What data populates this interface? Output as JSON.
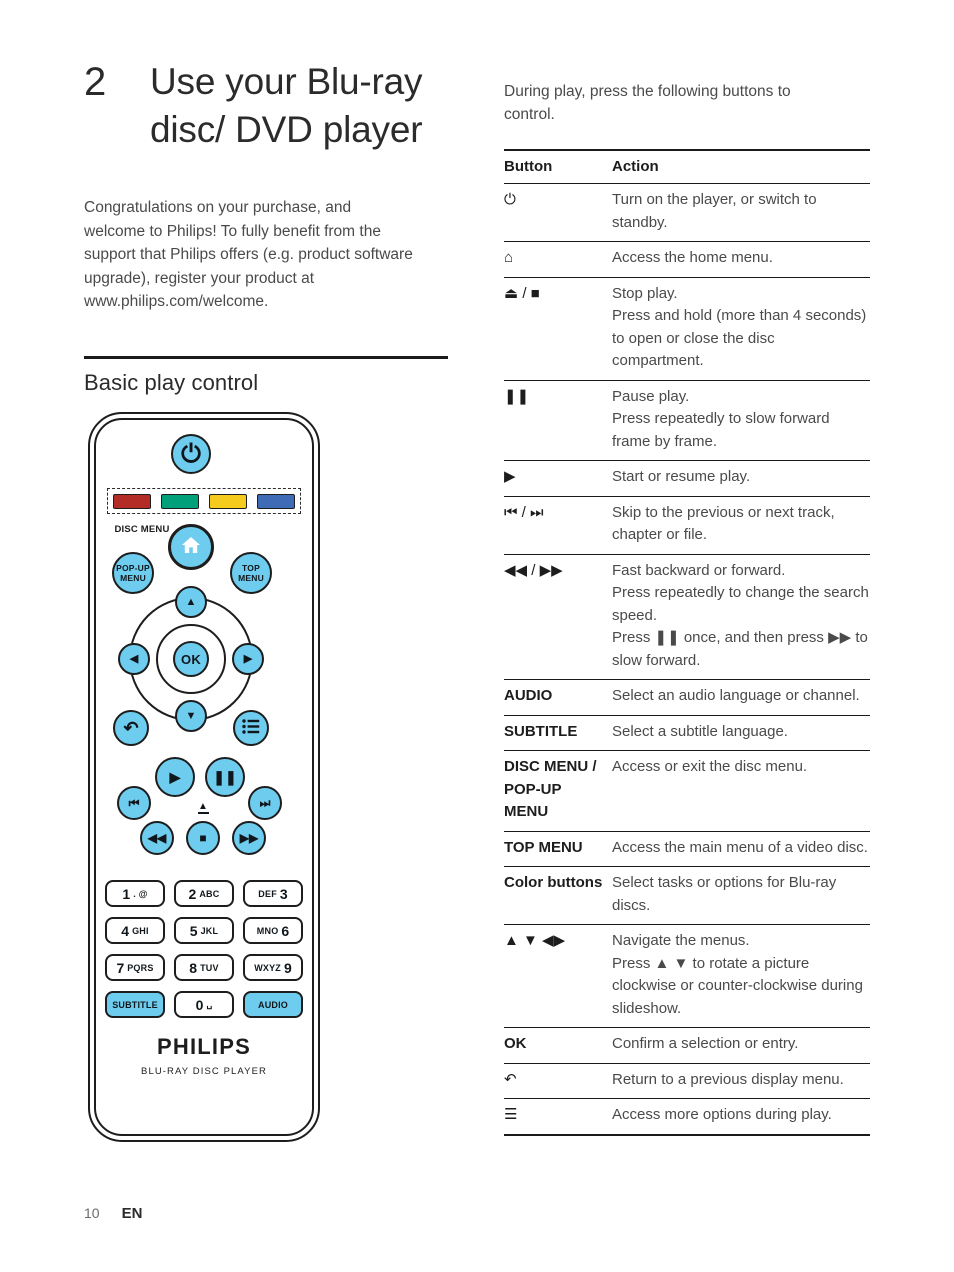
{
  "chapter": {
    "number": "2",
    "title": "Use your Blu-ray disc/ DVD player",
    "intro": "Congratulations on your purchase, and welcome to Philips! To fully benefit from the support that Philips offers (e.g. product software upgrade), register your product at www.philips.com/welcome."
  },
  "section": {
    "title": "Basic play control"
  },
  "remote": {
    "power_symbol": "⏻",
    "color_buttons": [
      {
        "name": "red",
        "hex": "#b32d26"
      },
      {
        "name": "green",
        "hex": "#00a07a"
      },
      {
        "name": "yellow",
        "hex": "#f5cb1e"
      },
      {
        "name": "blue",
        "hex": "#3f6ab5"
      }
    ],
    "home_symbol": "⌂",
    "disc_menu_label": "DISC MENU",
    "popup_menu_label": "POP-UP MENU",
    "top_menu_label": "TOP MENU",
    "nav_up": "▲",
    "nav_down": "▼",
    "nav_left": "◀",
    "nav_right": "▶",
    "ok_label": "OK",
    "back_symbol": "↶",
    "options_symbol": "☰",
    "play_symbol": "▶",
    "pause_symbol": "❚❚",
    "prev_symbol": "⏮",
    "next_symbol": "⏭",
    "rewind_symbol": "◀◀",
    "stop_symbol": "■",
    "forward_symbol": "▶▶",
    "eject_symbol": "▲",
    "keypad": [
      {
        "num": "1",
        "letters": ". @",
        "accent": false
      },
      {
        "num": "2",
        "letters": "ABC",
        "accent": false
      },
      {
        "num": "3",
        "letters": "DEF",
        "accent": false,
        "letters_first": true
      },
      {
        "num": "4",
        "letters": "GHI",
        "accent": false
      },
      {
        "num": "5",
        "letters": "JKL",
        "accent": false
      },
      {
        "num": "6",
        "letters": "MNO",
        "accent": false,
        "letters_first": true
      },
      {
        "num": "7",
        "letters": "PQRS",
        "accent": false
      },
      {
        "num": "8",
        "letters": "TUV",
        "accent": false
      },
      {
        "num": "9",
        "letters": "WXYZ",
        "accent": false,
        "letters_first": true
      },
      {
        "word": "SUBTITLE",
        "accent": true
      },
      {
        "num": "0",
        "letters": "␣",
        "accent": false
      },
      {
        "word": "AUDIO",
        "accent": true
      }
    ],
    "brand": "PHILIPS",
    "brand_sub": "BLU-RAY DISC PLAYER",
    "button_fill": "#6ecdef"
  },
  "right": {
    "lead": "During play, press the following buttons to control.",
    "table": {
      "headers": [
        "Button",
        "Action"
      ],
      "rows": [
        {
          "button": "⏻",
          "symbol": true,
          "lines": [
            "Turn on the player, or switch to standby."
          ]
        },
        {
          "button": "⌂",
          "symbol": true,
          "lines": [
            "Access the home menu."
          ]
        },
        {
          "button": "⏏ / ■",
          "symbol": true,
          "lines": [
            "Stop play.",
            "Press and hold (more than 4 seconds) to open or close the disc compartment."
          ]
        },
        {
          "button": "❚❚",
          "symbol": true,
          "lines": [
            "Pause play.",
            "Press repeatedly to slow forward frame by frame."
          ]
        },
        {
          "button": "▶",
          "symbol": true,
          "lines": [
            "Start or resume play."
          ]
        },
        {
          "button": "⏮ / ⏭",
          "symbol": true,
          "lines": [
            "Skip to the previous or next track, chapter or file."
          ]
        },
        {
          "button": "◀◀ / ▶▶",
          "symbol": true,
          "lines": [
            "Fast backward or forward.",
            "Press repeatedly to change the search speed.",
            "Press ❚❚ once, and then press ▶▶ to slow forward."
          ]
        },
        {
          "button": "AUDIO",
          "symbol": false,
          "lines": [
            "Select an audio language or channel."
          ]
        },
        {
          "button": "SUBTITLE",
          "symbol": false,
          "lines": [
            "Select a subtitle language."
          ]
        },
        {
          "button": "DISC MENU / POP-UP MENU",
          "symbol": false,
          "lines": [
            "Access or exit the disc menu."
          ]
        },
        {
          "button": "TOP MENU",
          "symbol": false,
          "lines": [
            "Access the main menu of a video disc."
          ]
        },
        {
          "button": "Color buttons",
          "symbol": false,
          "lines": [
            "Select tasks or options for Blu-ray discs."
          ]
        },
        {
          "button": "▲ ▼ ◀▶",
          "symbol": true,
          "lines": [
            "Navigate the menus.",
            "Press ▲ ▼ to rotate a picture clockwise or counter-clockwise during slideshow."
          ]
        },
        {
          "button": "OK",
          "symbol": false,
          "lines": [
            "Confirm a selection or entry."
          ]
        },
        {
          "button": "↶",
          "symbol": true,
          "lines": [
            "Return to a previous display menu."
          ]
        },
        {
          "button": "☰",
          "symbol": true,
          "lines": [
            "Access more options during play."
          ]
        }
      ]
    }
  },
  "footer": {
    "page": "10",
    "language": "EN"
  }
}
